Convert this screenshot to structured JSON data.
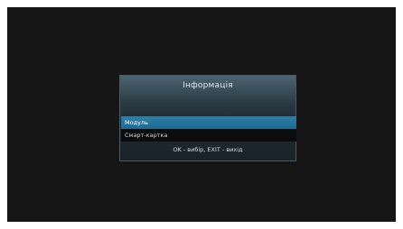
{
  "dialog": {
    "title": "Інформація",
    "items": [
      {
        "label": "Модуль",
        "selected": true
      },
      {
        "label": "Смарт-картка",
        "selected": false
      }
    ],
    "hint": "OK - вибір, EXIT - вихід"
  },
  "colors": {
    "screen_background": "#161616",
    "selected_item": "#2f7fa6",
    "item_background": "#0c0c0c"
  }
}
